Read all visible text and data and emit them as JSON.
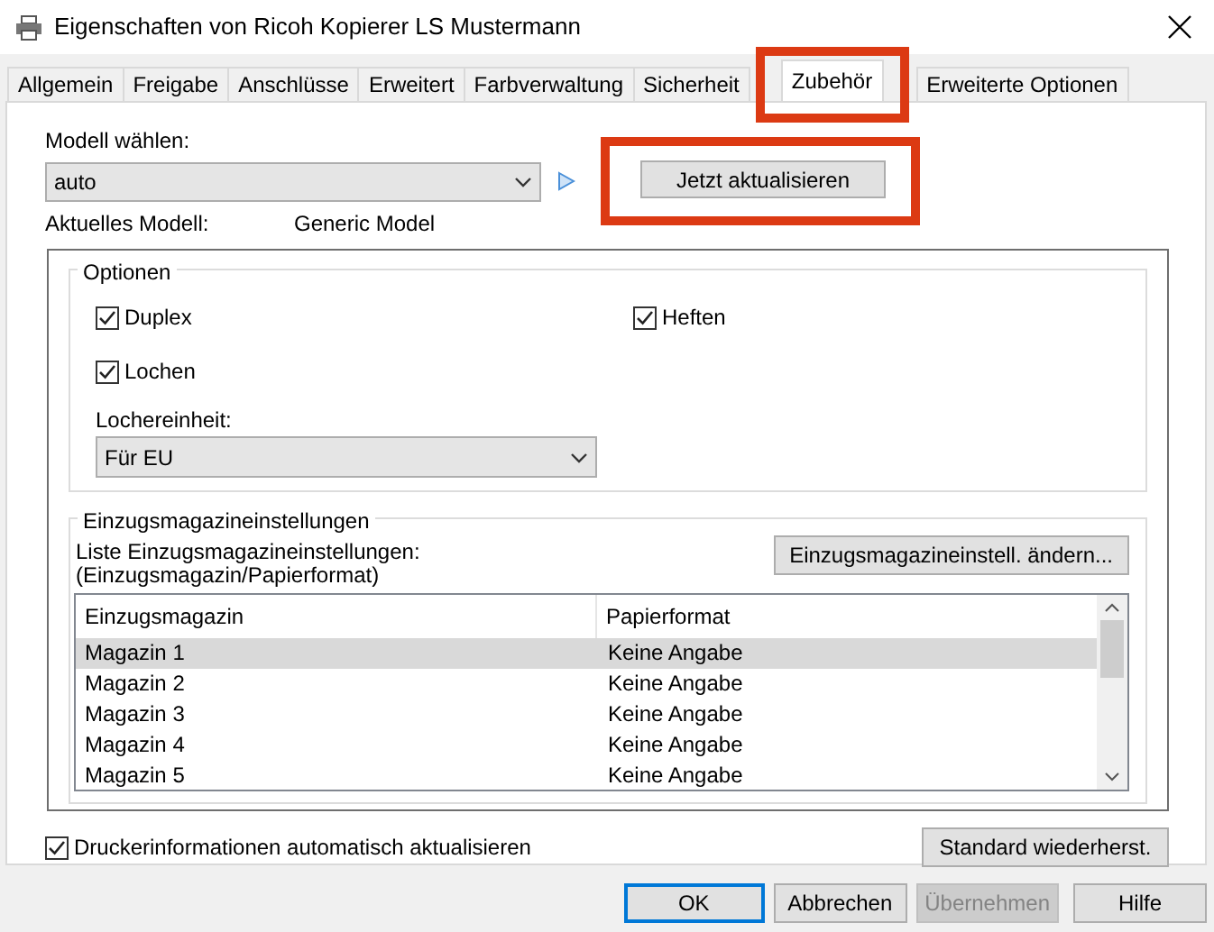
{
  "window": {
    "title": "Eigenschaften von Ricoh Kopierer LS Mustermann"
  },
  "tabs": [
    {
      "label": "Allgemein",
      "selected": false,
      "highlighted": false
    },
    {
      "label": "Freigabe",
      "selected": false,
      "highlighted": false
    },
    {
      "label": "Anschlüsse",
      "selected": false,
      "highlighted": false
    },
    {
      "label": "Erweitert",
      "selected": false,
      "highlighted": false
    },
    {
      "label": "Farbverwaltung",
      "selected": false,
      "highlighted": false
    },
    {
      "label": "Sicherheit",
      "selected": false,
      "highlighted": false
    },
    {
      "label": "Zubehör",
      "selected": true,
      "highlighted": true
    },
    {
      "label": "Erweiterte Optionen",
      "selected": false,
      "highlighted": false
    }
  ],
  "model": {
    "label": "Modell wählen:",
    "value": "auto",
    "update_button": {
      "label": "Jetzt aktualisieren",
      "highlighted": true
    },
    "current_label": "Aktuelles Modell:",
    "current_value": "Generic Model"
  },
  "options": {
    "title": "Optionen",
    "checkboxes": [
      {
        "label": "Duplex",
        "checked": true
      },
      {
        "label": "Heften",
        "checked": true
      },
      {
        "label": "Lochen",
        "checked": true
      }
    ],
    "punch_label": "Lochereinheit:",
    "punch_value": "Für EU"
  },
  "trays": {
    "title": "Einzugsmagazineinstellungen",
    "list_label": [
      "Liste Einzugsmagazineinstellungen:",
      "(Einzugsmagazin/Papierformat)"
    ],
    "change_button": "Einzugsmagazineinstell. ändern...",
    "columns": [
      "Einzugsmagazin",
      "Papierformat"
    ],
    "rows": [
      {
        "cells": [
          "Magazin 1",
          "Keine Angabe"
        ],
        "selected": true
      },
      {
        "cells": [
          "Magazin 2",
          "Keine Angabe"
        ],
        "selected": false
      },
      {
        "cells": [
          "Magazin 3",
          "Keine Angabe"
        ],
        "selected": false
      },
      {
        "cells": [
          "Magazin 4",
          "Keine Angabe"
        ],
        "selected": false
      },
      {
        "cells": [
          "Magazin 5",
          "Keine Angabe"
        ],
        "selected": false
      }
    ]
  },
  "auto_update": {
    "label": "Druckerinformationen automatisch aktualisieren",
    "checked": true
  },
  "restore_button": "Standard wiederherst.",
  "buttons": [
    {
      "label": "OK",
      "default": true,
      "disabled": false
    },
    {
      "label": "Abbrechen",
      "default": false,
      "disabled": false
    },
    {
      "label": "Übernehmen",
      "default": false,
      "disabled": true
    },
    {
      "label": "Hilfe",
      "default": false,
      "disabled": false
    }
  ]
}
